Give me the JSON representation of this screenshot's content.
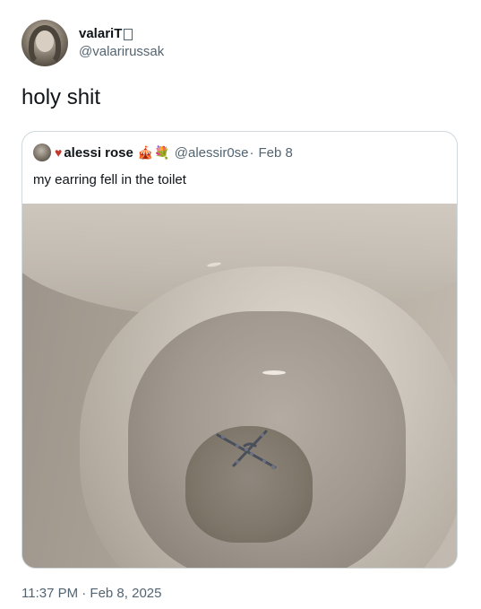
{
  "tweet": {
    "author": {
      "name": "valariT",
      "handle": "@valarirussak"
    },
    "text": "holy shit",
    "timestamp": "11:37 PM · Feb 8, 2025"
  },
  "quote": {
    "author": {
      "name": "alessi rose",
      "emoji": "🎪💐",
      "handle": "@alessir0se",
      "separator": "·",
      "date": "Feb 8"
    },
    "text": "my earring fell in the toilet"
  },
  "colors": {
    "text_primary": "#0f1419",
    "text_secondary": "#536471",
    "border": "#cfd9de",
    "heart": "#c0392b"
  },
  "icons": {
    "heart": "heart-icon",
    "verified_placeholder": "box-icon"
  }
}
